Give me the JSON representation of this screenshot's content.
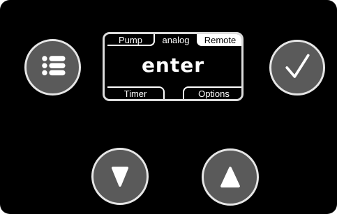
{
  "display": {
    "tabs": {
      "pump": "Pump",
      "analog": "analog",
      "remote": "Remote",
      "timer": "Timer",
      "options": "Options"
    },
    "main_text": "enter"
  },
  "buttons": {
    "menu": "list-icon",
    "confirm": "checkmark-icon",
    "down": "triangle-down-icon",
    "up": "triangle-up-icon"
  },
  "colors": {
    "panel": "#000000",
    "button_fill": "#5a5a5a",
    "button_ring": "#e6e6e6",
    "display_text": "#ffffff"
  }
}
